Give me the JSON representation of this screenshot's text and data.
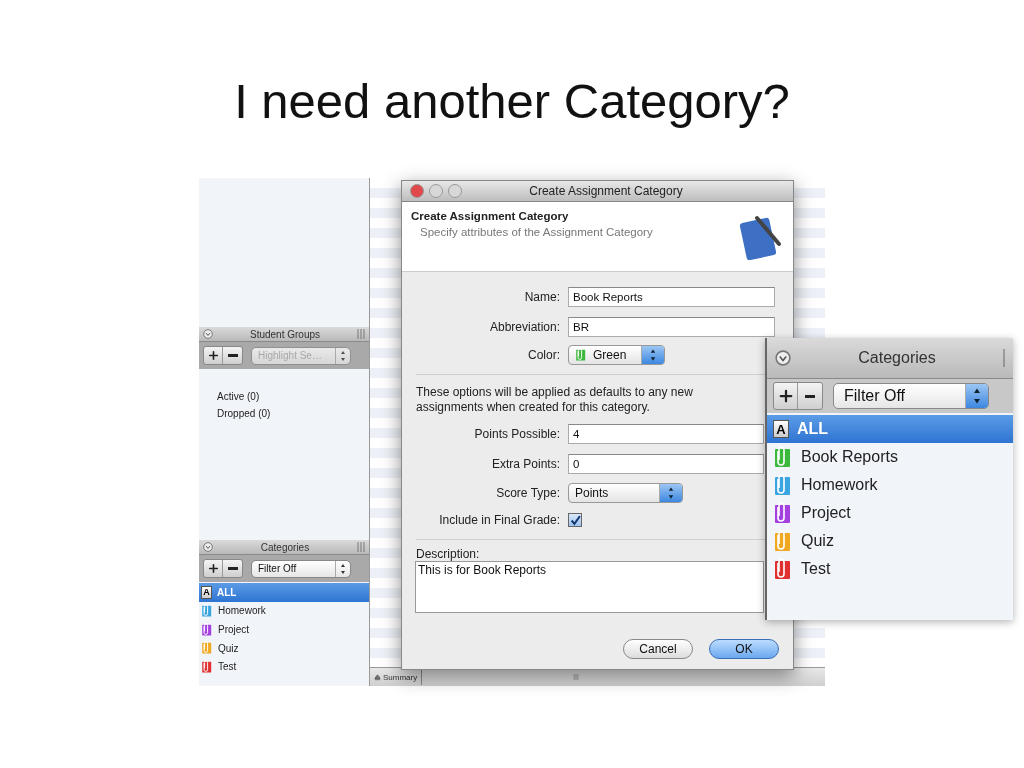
{
  "slide_title": "I need another Category?",
  "sidebar": {
    "student_groups": {
      "title": "Student Groups",
      "popup": {
        "value": "Highlight Se…",
        "disabled": true
      },
      "items": [
        {
          "label": "Active (0)"
        },
        {
          "label": "Dropped (0)"
        }
      ]
    },
    "categories": {
      "title": "Categories",
      "popup": {
        "value": "Filter Off",
        "disabled": false
      },
      "items": [
        {
          "kind": "letter",
          "badge": "A",
          "label": "ALL",
          "selected": true
        },
        {
          "kind": "clip",
          "label": "Homework",
          "color": "#3aa5e0",
          "selected": false
        },
        {
          "kind": "clip",
          "label": "Project",
          "color": "#a440e0",
          "selected": false
        },
        {
          "kind": "clip",
          "label": "Quiz",
          "color": "#f0a820",
          "selected": false
        },
        {
          "kind": "clip",
          "label": "Test",
          "color": "#e03030",
          "selected": false
        }
      ]
    }
  },
  "bottom_bar": {
    "tab": "Summary"
  },
  "dialog": {
    "title": "Create Assignment Category",
    "header_title": "Create Assignment Category",
    "header_subtitle": "Specify attributes of the Assignment Category",
    "fields": [
      {
        "kind": "text",
        "label": "Name:",
        "value": "Book Reports"
      },
      {
        "kind": "text",
        "label": "Abbreviation:",
        "value": "BR"
      },
      {
        "kind": "popup",
        "label": "Color:",
        "value": "Green",
        "color": "#3cb83c"
      }
    ],
    "note": "These options will be applied as defaults to any new assignments when created for this category.",
    "defaults": [
      {
        "kind": "text",
        "label": "Points Possible:",
        "value": "4"
      },
      {
        "kind": "text",
        "label": "Extra Points:",
        "value": "0"
      },
      {
        "kind": "popup",
        "label": "Score Type:",
        "value": "Points"
      },
      {
        "kind": "checkbox",
        "label": "Include in Final Grade:",
        "checked": true
      }
    ],
    "description": {
      "label": "Description:",
      "value": "This is for Book Reports"
    },
    "buttons": [
      {
        "label": "Cancel",
        "default": false
      },
      {
        "label": "OK",
        "default": true
      }
    ]
  },
  "zoomed_categories": {
    "title": "Categories",
    "popup": {
      "value": "Filter Off",
      "disabled": false
    },
    "items": [
      {
        "kind": "letter",
        "badge": "A",
        "label": "ALL",
        "selected": true
      },
      {
        "kind": "clip",
        "label": "Book Reports",
        "color": "#3cb83c",
        "selected": false
      },
      {
        "kind": "clip",
        "label": "Homework",
        "color": "#3aa5e0",
        "selected": false
      },
      {
        "kind": "clip",
        "label": "Project",
        "color": "#a440e0",
        "selected": false
      },
      {
        "kind": "clip",
        "label": "Quiz",
        "color": "#f0a820",
        "selected": false
      },
      {
        "kind": "clip",
        "label": "Test",
        "color": "#e03030",
        "selected": false
      }
    ]
  }
}
